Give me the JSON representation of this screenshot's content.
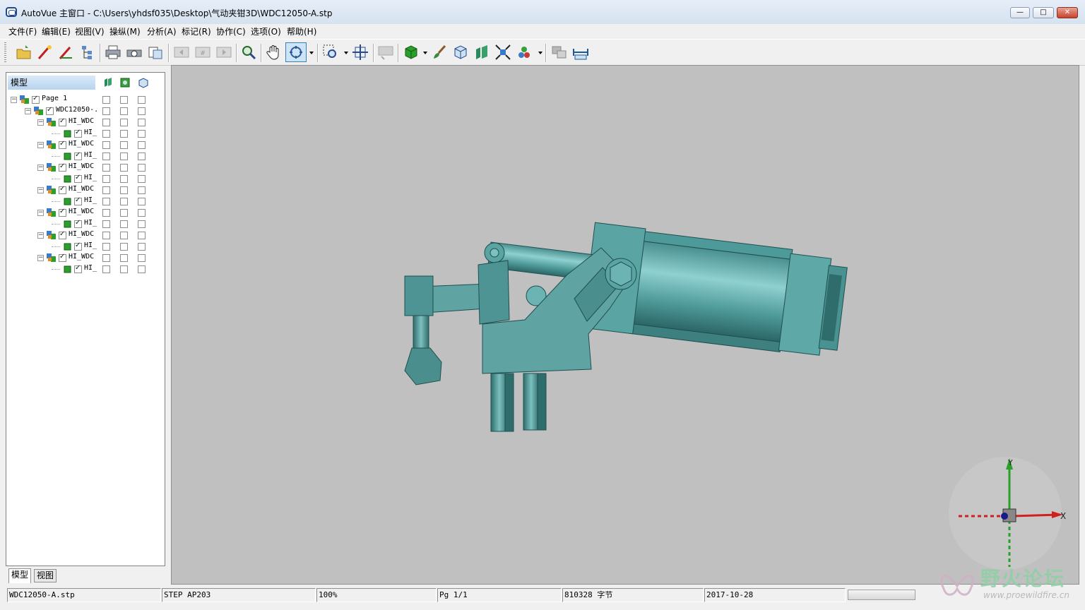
{
  "window": {
    "title": "AutoVue 主窗口 - C:\\Users\\yhdsf035\\Desktop\\气动夹钳3D\\WDC12050-A.stp",
    "minimize_label": "—",
    "maximize_label": "□",
    "close_label": "✕"
  },
  "menu": [
    "文件(F)",
    "编辑(E)",
    "视图(V)",
    "操纵(M)",
    "分析(A)",
    "标记(R)",
    "协作(C)",
    "选项(O)",
    "帮助(H)"
  ],
  "toolbar": {
    "buttons": [
      "open-icon",
      "markup-icon",
      "markup-edit-icon",
      "tree-icon",
      "print-icon",
      "print-preview-icon",
      "copy-icon",
      "prev-page-icon",
      "page-icon",
      "next-page-icon",
      "zoom-search-icon",
      "pan-hand-icon",
      "rotate-icon",
      "zoom-box-icon",
      "fit-icon",
      "measure-disabled-icon",
      "shaded-cube-icon",
      "paint-brush-icon",
      "wireframe-cube-icon",
      "section-icon",
      "explode-icon",
      "assembly-icon",
      "compare-icon",
      "measure-icon"
    ]
  },
  "tree": {
    "header_label": "模型",
    "header_icons": [
      "visibility-icon",
      "transparency-icon",
      "wireframe-icon"
    ],
    "nodes": [
      {
        "label": "Page 1",
        "level": 0,
        "checked": true
      },
      {
        "label": "WDC12050-.",
        "level": 1,
        "checked": true
      },
      {
        "label": "HI_WDC",
        "level": 2,
        "checked": true
      },
      {
        "label": "HI_",
        "level": 3,
        "checked": true
      },
      {
        "label": "HI_WDC",
        "level": 2,
        "checked": true
      },
      {
        "label": "HI_",
        "level": 3,
        "checked": true
      },
      {
        "label": "HI_WDC",
        "level": 2,
        "checked": true
      },
      {
        "label": "HI_",
        "level": 3,
        "checked": true
      },
      {
        "label": "HI_WDC",
        "level": 2,
        "checked": true
      },
      {
        "label": "HI_",
        "level": 3,
        "checked": true
      },
      {
        "label": "HI_WDC",
        "level": 2,
        "checked": true
      },
      {
        "label": "HI_",
        "level": 3,
        "checked": true
      },
      {
        "label": "HI_WDC",
        "level": 2,
        "checked": true
      },
      {
        "label": "HI_",
        "level": 3,
        "checked": true
      },
      {
        "label": "HI_WDC",
        "level": 2,
        "checked": true
      },
      {
        "label": "HI_",
        "level": 3,
        "checked": true
      }
    ]
  },
  "tabs": [
    "模型",
    "视图"
  ],
  "axis_labels": {
    "y": "Y",
    "x": "X"
  },
  "status": {
    "file": "WDC12050-A.stp",
    "format": "STEP AP203",
    "zoom": "100%",
    "page": "Pg 1/1",
    "size": "810328 字节",
    "date": "2017-10-28"
  },
  "watermark": {
    "text": "野火论坛",
    "url": "www.proewildfire.cn"
  },
  "colors": {
    "model": "#5fa3a3",
    "model_dark": "#2f6c6c",
    "viewport_bg": "#c0c0c0"
  }
}
